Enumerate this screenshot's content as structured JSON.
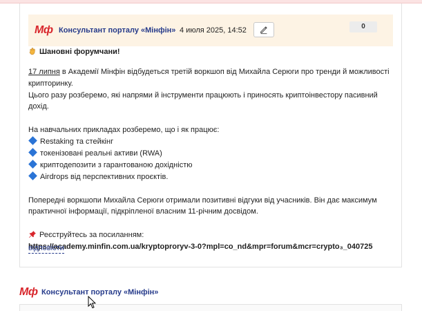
{
  "post": {
    "logo": "Мф",
    "author": "Консультант порталу «Мінфін»",
    "date": "4 июля 2025, 14:52",
    "counter": "0",
    "greeting": "Шановні форумчани!",
    "intro_date": "17 липня",
    "intro_rest": " в Академії Мінфін відбудеться третій воркшоп від Михайла Серюги про тренди й можливості крипторинку.",
    "intro_2": "Цього разу розберемо, які напрями й інструменти працюють і приносять криптоінвестору пасивний дохід.",
    "examples_intro": "На навчальних прикладах розберемо, що і як працює:",
    "bullets": [
      "Restaking та стейкінг",
      "токенізовані реальні активи (RWA)",
      "криптодепозити з гарантованою дохідністю",
      "Airdrops від перспективних проєктів."
    ],
    "feedback": "Попередні воркшопи Михайла Серюги отримали позитивні відгуки від учасників. Він дає максимум практичної інформації, підкріпленої власним 11-річним досвідом.",
    "register_label": "Реєструйтесь за посиланням:",
    "register_link": "https://academy.minfin.com.ua/kryptoproryv-3-0?mpl=co_nd&mpr=forum&mcr=crypto₃_040725",
    "reply_label": "відповісти"
  },
  "next_post": {
    "logo": "Мф",
    "author": "Консультант порталу «Мінфін»"
  },
  "icons": {
    "greeting_icon": "waving-hand-icon",
    "bullet_icon": "blue-diamond-icon",
    "register_icon": "pushpin-icon",
    "edit_icon": "pencil-icon"
  },
  "colors": {
    "brand_red": "#d8262c",
    "author_blue": "#253a8a",
    "header_bg": "#fdf3e4",
    "bullet_blue": "#2b74d6"
  }
}
